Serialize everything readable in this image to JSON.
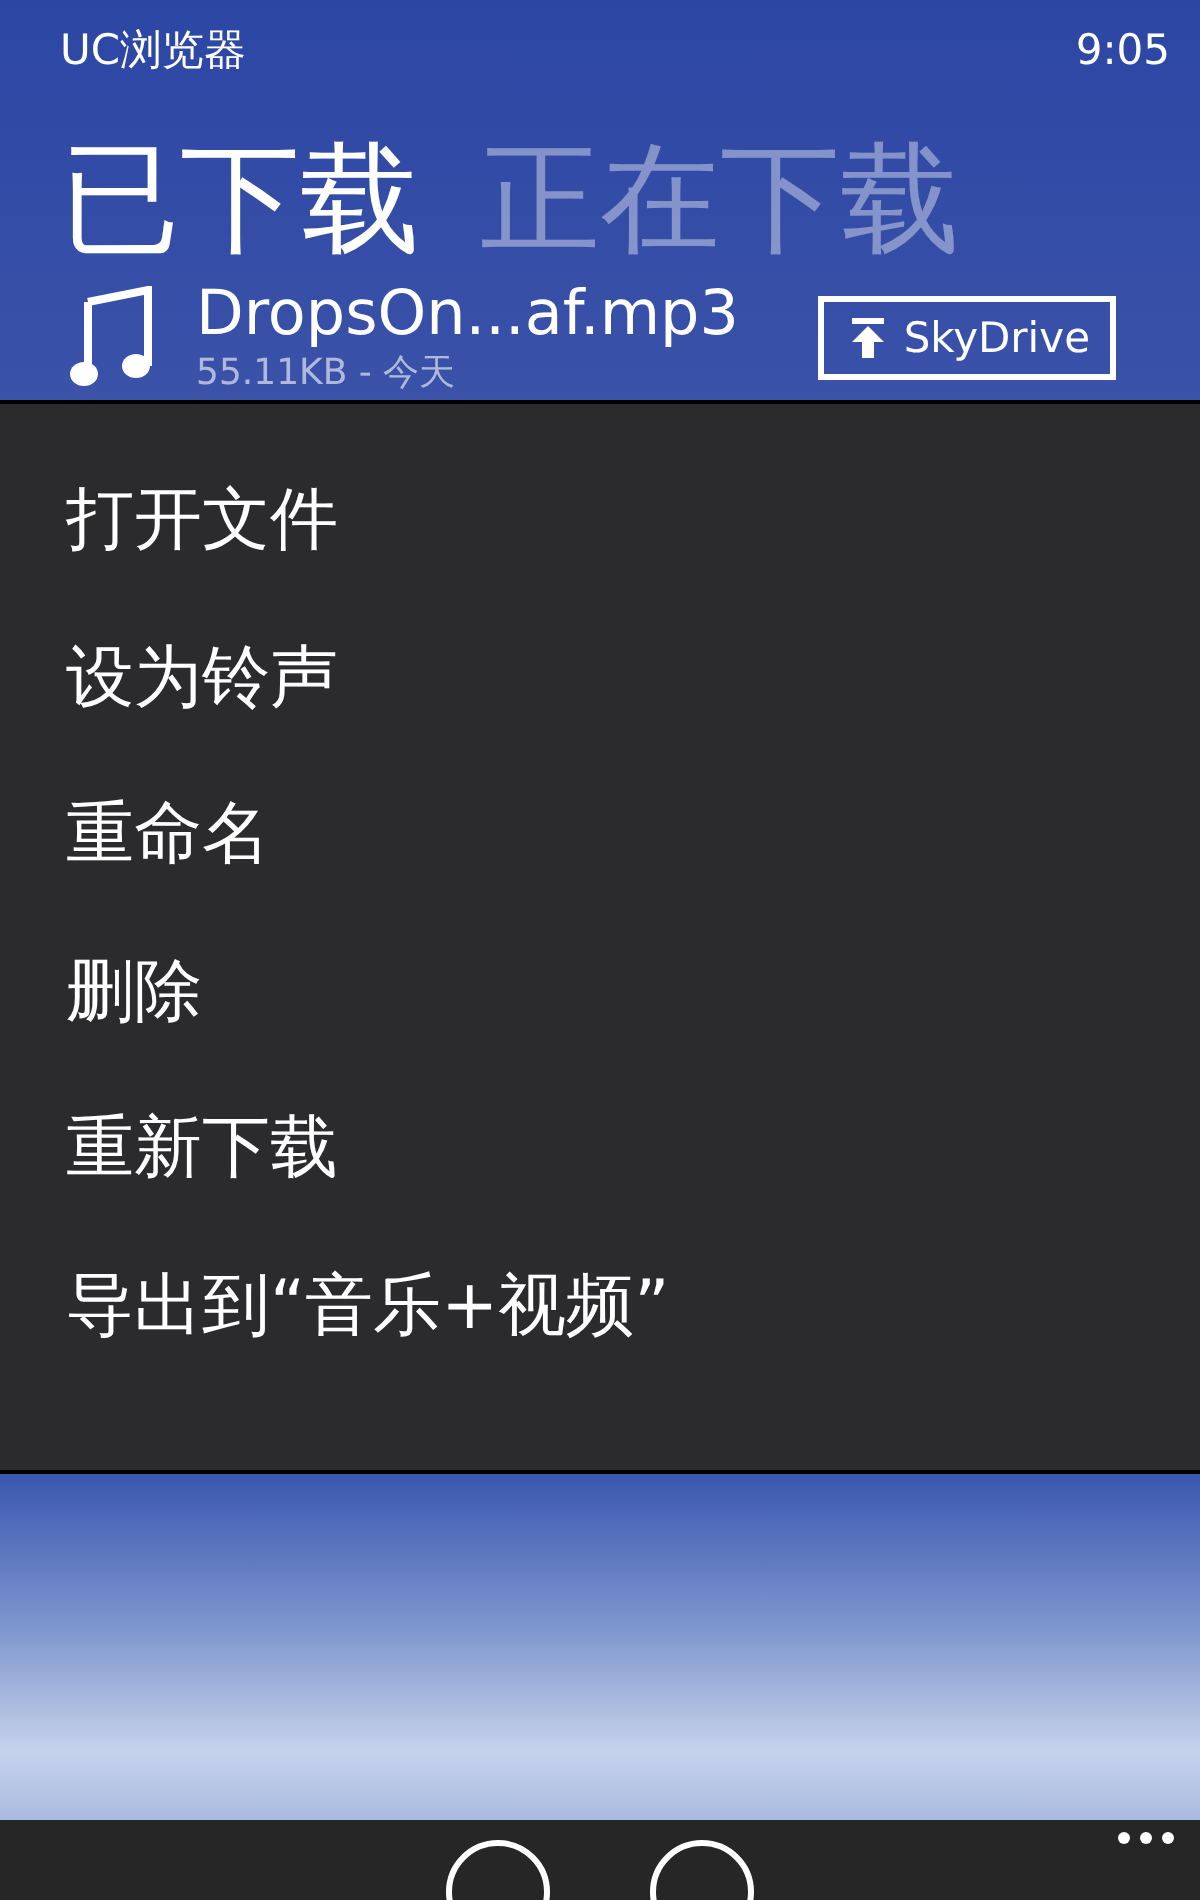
{
  "status_bar": {
    "app": "UC浏览器",
    "time": "9:05"
  },
  "pivots": [
    {
      "label": "已下载",
      "selected": true
    },
    {
      "label": "正在下载",
      "selected": false
    }
  ],
  "downloads": [
    {
      "name": "DropsOn...af.mp3",
      "meta": "55.11KB - 今天",
      "action": "SkyDrive"
    }
  ],
  "context_menu": [
    "打开文件",
    "设为铃声",
    "重命名",
    "删除",
    "重新下载",
    "导出到“音乐+视频”"
  ]
}
